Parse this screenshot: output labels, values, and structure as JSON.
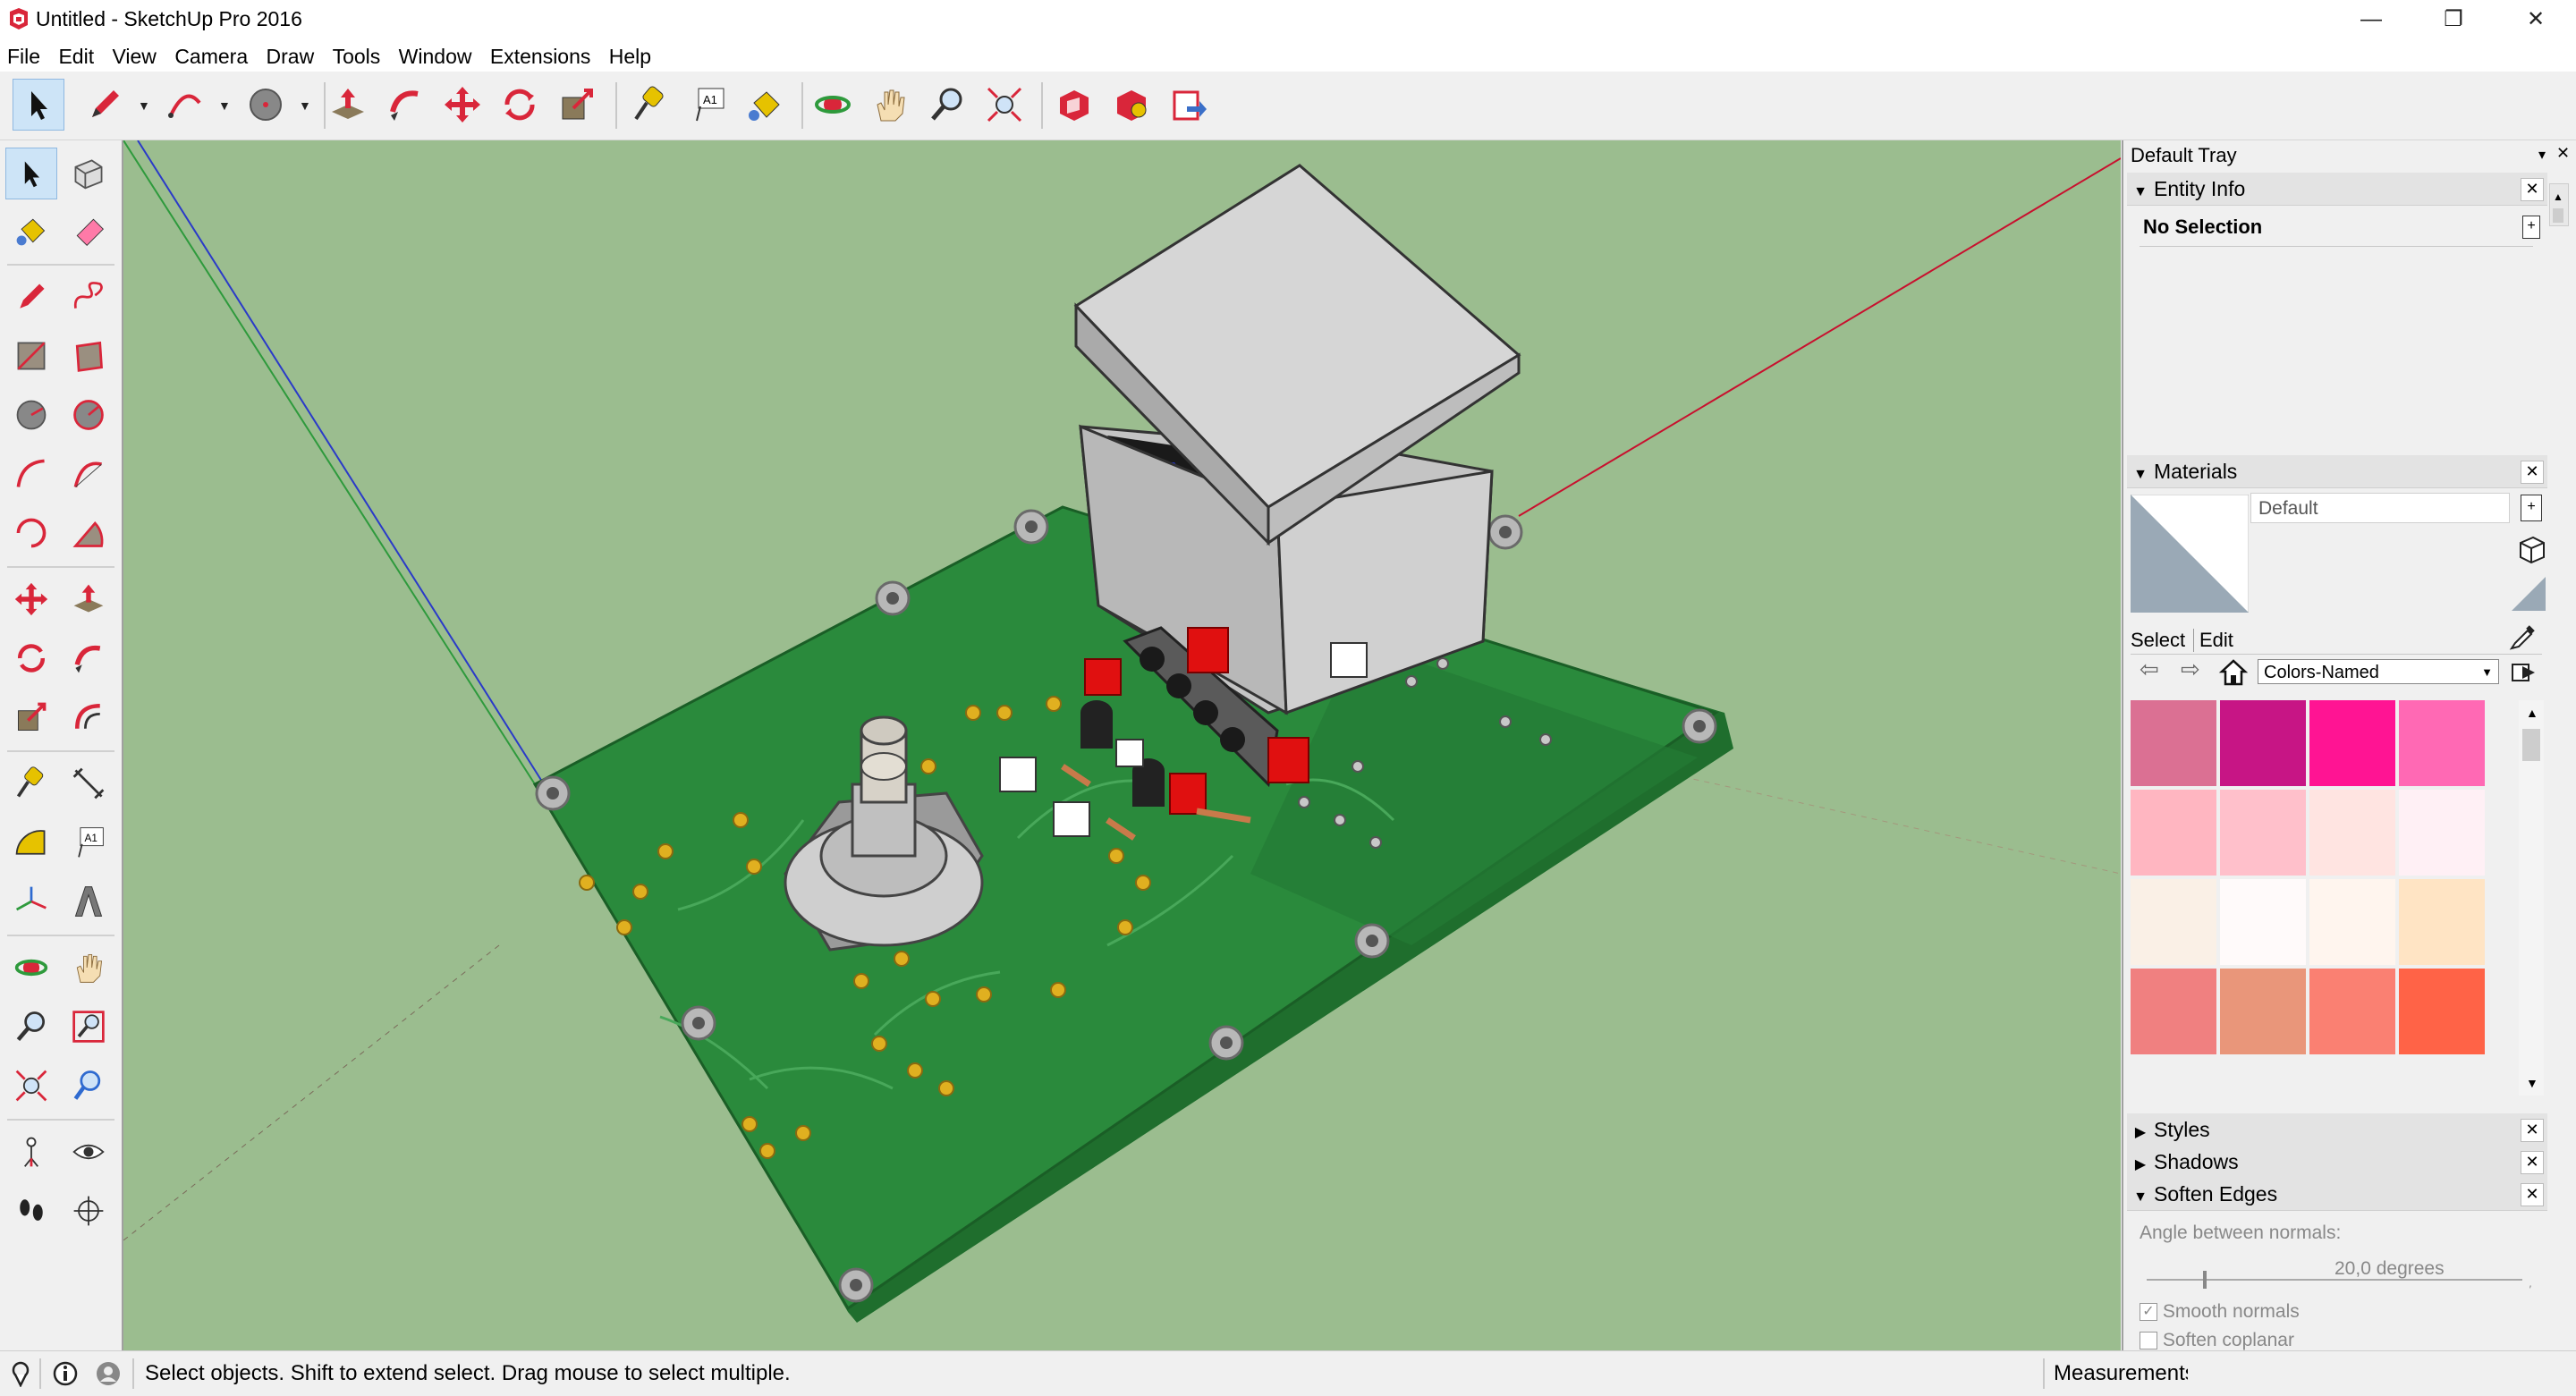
{
  "window": {
    "title": "Untitled - SketchUp Pro 2016",
    "minimize_glyph": "—",
    "restore_glyph": "❐",
    "close_glyph": "✕"
  },
  "menu": {
    "items": [
      "File",
      "Edit",
      "View",
      "Camera",
      "Draw",
      "Tools",
      "Window",
      "Extensions",
      "Help"
    ]
  },
  "toolbar": {
    "icons": [
      "select-icon",
      "pencil-icon",
      "arc-icon",
      "circle-icon",
      "push-pull-icon",
      "follow-me-icon",
      "move-icon",
      "rotate-icon",
      "scale-icon",
      "tape-measure-icon",
      "text-icon",
      "paint-bucket-icon",
      "orbit-icon",
      "pan-icon",
      "zoom-icon",
      "zoom-extents-icon",
      "warehouse-icon",
      "extension-warehouse-icon",
      "send-to-layout-icon"
    ]
  },
  "tray": {
    "title": "Default Tray",
    "pin_glyph": "▾",
    "close_glyph": "✕",
    "entity_info": {
      "title": "Entity Info",
      "selection": "No Selection"
    },
    "materials": {
      "title": "Materials",
      "material_name": "Default",
      "tab_select": "Select",
      "tab_edit": "Edit",
      "library": "Colors-Named",
      "swatches": [
        "#db7093",
        "#c71585",
        "#ff1493",
        "#ff69b4",
        "#ffb6c1",
        "#ffc0cb",
        "#ffe4e1",
        "#fff0f5",
        "#faf0e6",
        "#fffafa",
        "#fff5ee",
        "#ffe4c4",
        "#f08080",
        "#e9967a",
        "#fa8072",
        "#ff6347"
      ]
    },
    "styles": {
      "title": "Styles"
    },
    "shadows": {
      "title": "Shadows"
    },
    "soften_edges": {
      "title": "Soften Edges",
      "angle_label": "Angle between normals:",
      "angle_value": "20,0  degrees",
      "angle_fraction": 0.15,
      "smooth_normals": "Smooth normals",
      "smooth_normals_checked": true,
      "soften_coplanar": "Soften coplanar",
      "soften_coplanar_checked": false
    }
  },
  "status": {
    "message": "Select objects. Shift to extend select. Drag mouse to select multiple.",
    "measurements_label": "Measurements"
  },
  "colors": {
    "viewport_bg": "#9bbd8f",
    "pcb": "#2a8a3c",
    "sketchup_red": "#c8102e",
    "selection_blue": "#cde4f7"
  }
}
